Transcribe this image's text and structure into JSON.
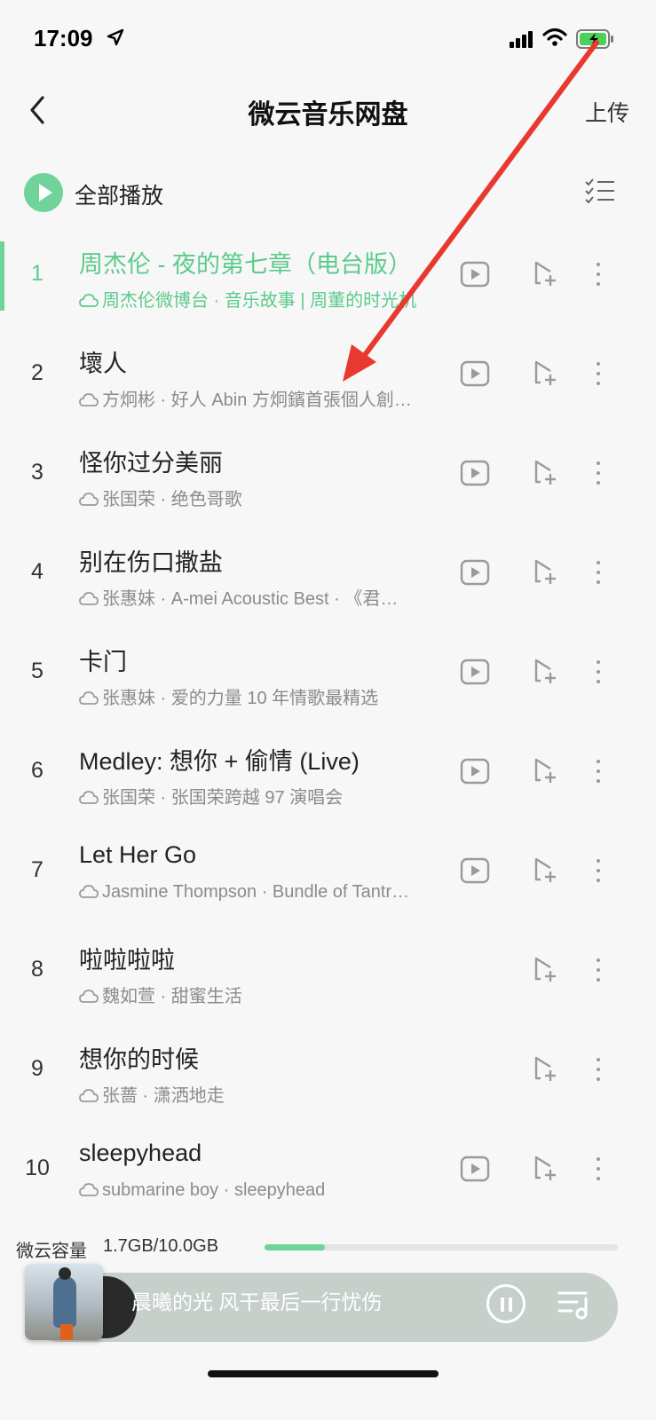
{
  "status_bar": {
    "time": "17:09"
  },
  "nav": {
    "title": "微云音乐网盘",
    "upload_label": "上传"
  },
  "toolbar": {
    "play_all_label": "全部播放"
  },
  "songs": [
    {
      "index": "1",
      "title": "周杰伦 - 夜的第七章（电台版）",
      "meta": "周杰伦微博台 · 音乐故事 | 周董的时光机",
      "has_mv": true,
      "active": true
    },
    {
      "index": "2",
      "title": "壞人",
      "meta": "方炯彬 · 好人 Abin 方炯鑌首張個人創…",
      "has_mv": true
    },
    {
      "index": "3",
      "title": "怪你过分美丽",
      "meta": "张国荣 · 绝色哥歌",
      "has_mv": true
    },
    {
      "index": "4",
      "title": "别在伤口撒盐",
      "meta": "张惠妹 · A-mei Acoustic Best · 《君…",
      "has_mv": true
    },
    {
      "index": "5",
      "title": "卡门",
      "meta": "张惠妹 · 爱的力量 10 年情歌最精选",
      "has_mv": true
    },
    {
      "index": "6",
      "title": "Medley: 想你 + 偷情 (Live)",
      "meta": "张国荣 · 张国荣跨越 97 演唱会",
      "has_mv": true
    },
    {
      "index": "7",
      "title": "Let Her Go",
      "meta": "Jasmine Thompson · Bundle of Tantr…",
      "has_mv": true
    },
    {
      "index": "8",
      "title": "啦啦啦啦",
      "meta": "魏如萱 · 甜蜜生活",
      "has_mv": false
    },
    {
      "index": "9",
      "title": "想你的时候",
      "meta": "张蔷 · 潇洒地走",
      "has_mv": false
    },
    {
      "index": "10",
      "title": "sleepyhead",
      "meta": "submarine boy · sleepyhead",
      "has_mv": true
    }
  ],
  "storage": {
    "label": "微云容量",
    "value": "1.7GB/10.0GB",
    "used_fraction": 0.17
  },
  "player": {
    "track": "晨曦的光 风干最后一行忧伤"
  },
  "colors": {
    "accent": "#6fd39a",
    "annotation": "#e8382f"
  },
  "icons": [
    "navigation-arrow-icon",
    "signal-icon",
    "wifi-icon",
    "battery-charging-icon",
    "back-chevron-icon",
    "play-circle-icon",
    "multiselect-icon",
    "cloud-icon",
    "mv-play-icon",
    "add-to-playlist-icon",
    "more-dots-icon",
    "pause-icon",
    "playlist-icon"
  ]
}
